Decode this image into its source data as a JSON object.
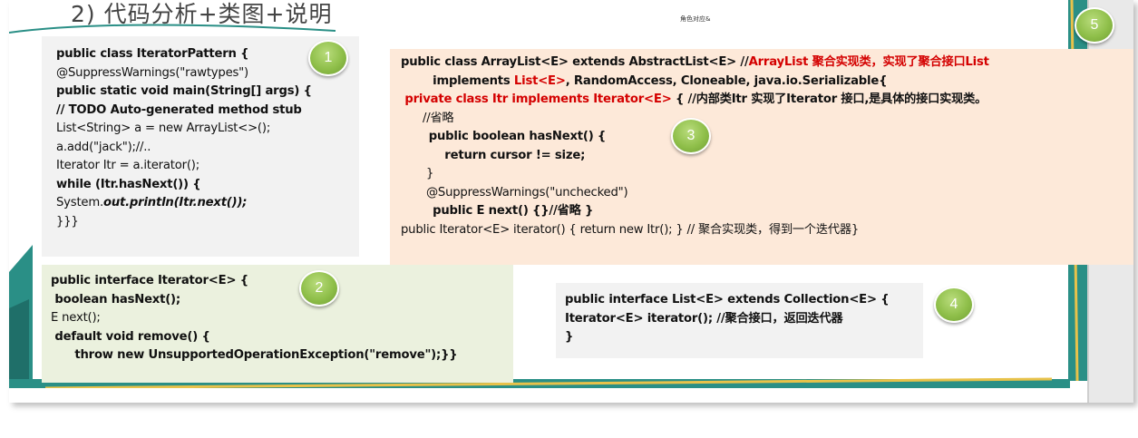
{
  "slide": {
    "heading": "2) 代码分析+类图+说明",
    "tiny_label": "角色对应&"
  },
  "badges": [
    "1",
    "2",
    "3",
    "4",
    "5"
  ],
  "colors": {
    "box1_bg": "#f2f2f2",
    "box2_bg": "#ebf1de",
    "box3_bg": "#fde9d9",
    "box4_bg": "#f2f2f2",
    "badge": "#8fbf4a",
    "highlight_red": "#d40000",
    "border_teal": "#2a8f86",
    "border_gold": "#e8c24a"
  },
  "box1": {
    "l1": "public class IteratorPattern {",
    "l2": "@SuppressWarnings(\"rawtypes\")",
    "l3": "public static void main(String[] args) {",
    "l4": "// TODO Auto-generated method stub",
    "l5": "List<String> a = new ArrayList<>();",
    "l6": "a.add(\"jack\");//..",
    "l7": "Iterator Itr = a.iterator();",
    "l8": "while (Itr.hasNext()) {",
    "l9a": "System.",
    "l9b": "out.println(Itr.next());",
    "l10": "}}}"
  },
  "box2": {
    "l1": "public interface Iterator<E> {",
    "l2": " boolean hasNext();",
    "l3": "E next();",
    "l4": " default void remove() {",
    "l5": "      throw new UnsupportedOperationException(\"remove\");}}"
  },
  "box3": {
    "l1a": "public class ArrayList<E> extends AbstractList<E> //",
    "l1b": "ArrayList 聚合实现类，实现了聚合接口List",
    "l2a": "        implements ",
    "l2b": "List<E>",
    "l2c": ", RandomAccess, Cloneable, java.io.Serializable{",
    "l3a": " private class Itr implements Iterator<E>",
    "l3b": " { //内部类Itr 实现了Iterator 接口,是具体的接口实现类。",
    "l4": "      //省略",
    "l5": "       public boolean hasNext() {",
    "l6": "           return cursor != size;",
    "l7": "       }",
    "l8": "       @SuppressWarnings(\"unchecked\")",
    "l9": "        public E next() {}//省略 }",
    "l10": "public Iterator<E> iterator() { return new Itr(); } // 聚合实现类，得到一个迭代器}"
  },
  "box4": {
    "l1": "public interface List<E> extends Collection<E> {",
    "l2": "Iterator<E> iterator(); //聚合接口，返回迭代器",
    "l3": "}"
  }
}
